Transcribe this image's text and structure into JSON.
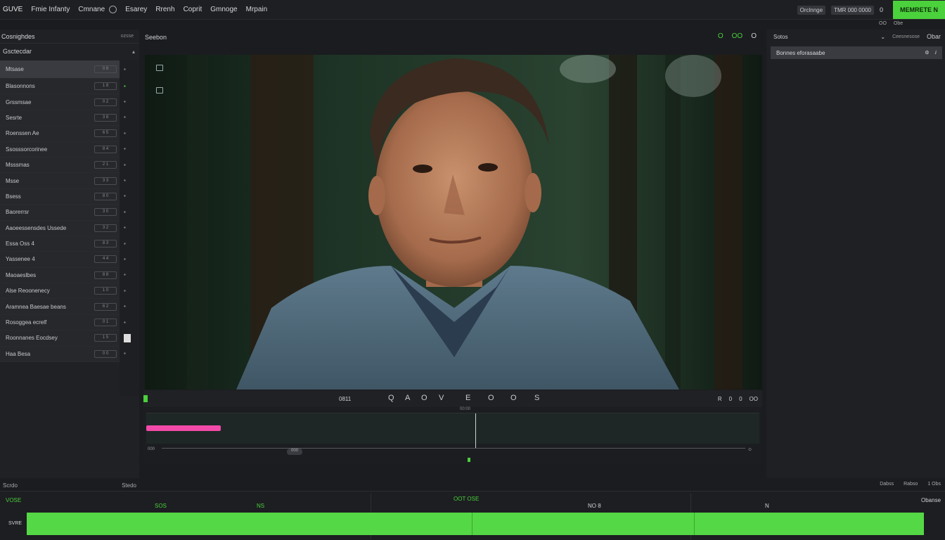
{
  "menu": {
    "items": [
      "GUVE",
      "Fmie Infanty",
      "Cmnane",
      "Esarey",
      "Rrenh",
      "Coprit",
      "Gmnoge",
      "Mrpain"
    ]
  },
  "topbar": {
    "chip1": "Orclnnge",
    "chip2": "TMR 000 0000",
    "zero": "0",
    "export_label": "MEMRETE N"
  },
  "left_panel": {
    "title": "Cosnighdes",
    "title_right": "ozsse",
    "subtitle": "Gsctecdar",
    "rows": [
      {
        "label": "Mtsase",
        "val": "0 8"
      },
      {
        "label": "Blasonnons",
        "val": "1 8"
      },
      {
        "label": "Grssmsae",
        "val": "0 2"
      },
      {
        "label": "Sesrte",
        "val": "3 8"
      },
      {
        "label": "Roenssen Ae",
        "val": "6 5"
      },
      {
        "label": "Ssosssorcorinee",
        "val": "8 4"
      },
      {
        "label": "Msssmas",
        "val": "2 1"
      },
      {
        "label": "Msse",
        "val": "3 3"
      },
      {
        "label": "Bsess",
        "val": "8 0"
      },
      {
        "label": "Baorerrsr",
        "val": "3 0"
      },
      {
        "label": "Aaoeessensdes Ussede",
        "val": "3 2"
      },
      {
        "label": "Essa Oss 4",
        "val": "8 3"
      },
      {
        "label": "Yassenee 4",
        "val": "4 4"
      },
      {
        "label": "Maoaeslbes",
        "val": "8 8"
      },
      {
        "label": "Alse Reoonenecy",
        "val": "1 0"
      },
      {
        "label": "Aramnea Baesae beans",
        "val": "6 2"
      },
      {
        "label": "Rosoggea ecrelf",
        "val": "0 1"
      },
      {
        "label": "Roonnanes Eocdsey",
        "val": "1 5"
      },
      {
        "label": "Haa Besa",
        "val": "0 0"
      }
    ],
    "bottom_left": "Scrdo",
    "bottom_right": "Stedo"
  },
  "viewer": {
    "title": "Seebon",
    "icons": [
      "O",
      "OO",
      "O"
    ]
  },
  "transport": {
    "timecode_left": "0811",
    "buttons": [
      "Q",
      "A",
      "O",
      "V",
      "E",
      "O",
      "O",
      "S"
    ],
    "right": [
      "R",
      "0",
      "0",
      "OO"
    ]
  },
  "mini_timeline": {
    "ruler_label": "00:00",
    "zoom_label": "000",
    "left_label": "000"
  },
  "right_panel": {
    "title": "Sotos",
    "item": "Bonnes eforasaabe",
    "top_labels": [
      "OO",
      "Obe",
      "Ceesnesose",
      "Obar"
    ],
    "bottom_labels": [
      "Dabss",
      "Rabso",
      "1 Obs"
    ]
  },
  "bottom_timeline": {
    "left_label": "VOSE",
    "ticks": [
      "SOS",
      "NS",
      "OOT OSE",
      "NO 8",
      "N"
    ],
    "track_label": "SVRE",
    "right_label": "Obanse"
  },
  "colors": {
    "accent_green": "#4bd13c",
    "clip_pink": "#f24aa8"
  }
}
